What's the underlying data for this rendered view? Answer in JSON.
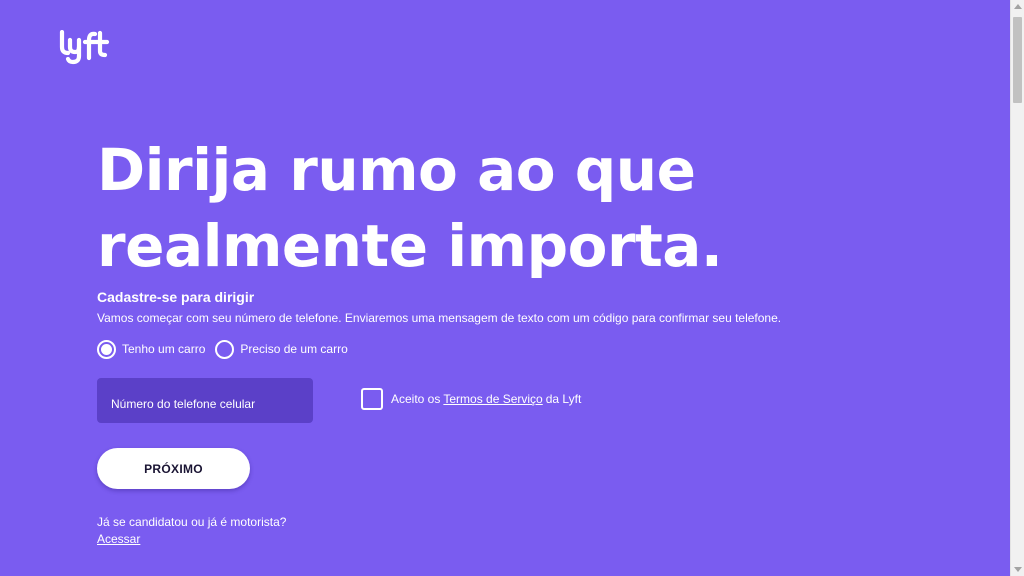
{
  "brand": {
    "logo_icon": "lyft-logo-icon",
    "background_color": "#7a5cf0",
    "input_color": "#5b40c8"
  },
  "hero": {
    "headline": "Dirija rumo ao que realmente importa."
  },
  "signup": {
    "title": "Cadastre-se para dirigir",
    "description": "Vamos começar com seu número de telefone. Enviaremos uma mensagem de texto com um código para confirmar seu telefone.",
    "options": [
      {
        "label": "Tenho um carro",
        "selected": true
      },
      {
        "label": "Preciso de um carro",
        "selected": false
      }
    ],
    "phone_placeholder": "Número do telefone celular",
    "terms": {
      "prefix": "Aceito os",
      "link_label": "Termos de Serviço",
      "suffix": "da Lyft",
      "checked": false
    },
    "next_label": "PRÓXIMO"
  },
  "footer": {
    "already_text": "Já se candidatou ou já é motorista?",
    "login_label": "Acessar"
  }
}
